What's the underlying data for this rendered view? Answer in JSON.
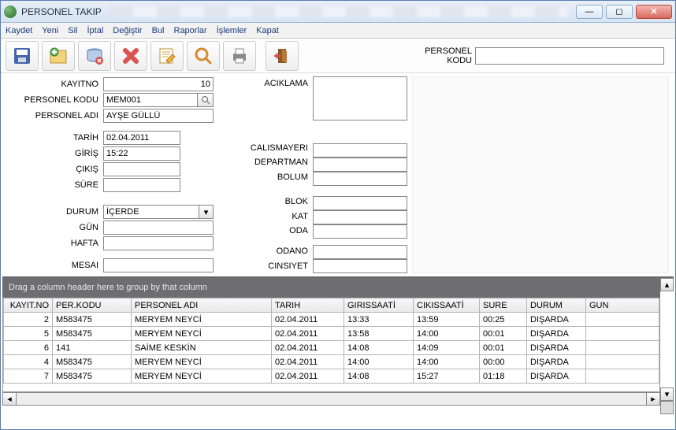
{
  "window": {
    "title": "PERSONEL TAKIP"
  },
  "menubar": [
    "Kaydet",
    "Yeni",
    "Sil",
    "İptal",
    "Değiştir",
    "Bul",
    "Raporlar",
    "İşlemler",
    "Kapat"
  ],
  "headerLookup": {
    "label1": "PERSONEL",
    "label2": "KODU",
    "value": ""
  },
  "form": {
    "kayitno_label": "KAYITNO",
    "kayitno": "10",
    "personelkodu_label": "PERSONEL KODU",
    "personelkodu": "MEM001",
    "personeladi_label": "PERSONEL ADI",
    "personeladi": "AYŞE GÜLLÜ",
    "tarih_label": "TARİH",
    "tarih": "02.04.2011",
    "giris_label": "GİRİŞ",
    "giris": "15:22",
    "cikis_label": "ÇIKIŞ",
    "cikis": "",
    "sure_label": "SÜRE",
    "sure": "",
    "durum_label": "DURUM",
    "durum": "İÇERDE",
    "gun_label": "GÜN",
    "gun": "",
    "hafta_label": "HAFTA",
    "hafta": "",
    "mesai_label": "MESAI",
    "mesai": "",
    "aciklama_label": "ACIKLAMA",
    "aciklama": "",
    "calismayeri_label": "CALISMAYERI",
    "calismayeri": "",
    "departman_label": "DEPARTMAN",
    "departman": "",
    "bolum_label": "BOLUM",
    "bolum": "",
    "blok_label": "BLOK",
    "blok": "",
    "kat_label": "KAT",
    "kat": "",
    "oda_label": "ODA",
    "oda": "",
    "odano_label": "ODANO",
    "odano": "",
    "cinsiyet_label": "CINSIYET",
    "cinsiyet": ""
  },
  "grid": {
    "groupHint": "Drag a column header here to group by that column",
    "columns": [
      "KAYIT.NO",
      "PER.KODU",
      "PERSONEL ADI",
      "TARIH",
      "GIRISSAATİ",
      "CIKISSAATİ",
      "SURE",
      "DURUM",
      "GUN"
    ],
    "rows": [
      {
        "no": "2",
        "kodu": "M583475",
        "adi": "MERYEM NEYCİ",
        "tarih": "02.04.2011",
        "giris": "13:33",
        "cikis": "13:59",
        "sure": "00:25",
        "durum": "DIŞARDA",
        "gun": ""
      },
      {
        "no": "5",
        "kodu": "M583475",
        "adi": "MERYEM NEYCİ",
        "tarih": "02.04.2011",
        "giris": "13:58",
        "cikis": "14:00",
        "sure": "00:01",
        "durum": "DIŞARDA",
        "gun": ""
      },
      {
        "no": "6",
        "kodu": "141",
        "adi": "SAİME KESKİN",
        "tarih": "02.04.2011",
        "giris": "14:08",
        "cikis": "14:09",
        "sure": "00:01",
        "durum": "DIŞARDA",
        "gun": ""
      },
      {
        "no": "4",
        "kodu": "M583475",
        "adi": "MERYEM NEYCİ",
        "tarih": "02.04.2011",
        "giris": "14:00",
        "cikis": "14:00",
        "sure": "00:00",
        "durum": "DIŞARDA",
        "gun": ""
      },
      {
        "no": "7",
        "kodu": "M583475",
        "adi": "MERYEM NEYCİ",
        "tarih": "02.04.2011",
        "giris": "14:08",
        "cikis": "15:27",
        "sure": "01:18",
        "durum": "DIŞARDA",
        "gun": ""
      }
    ]
  }
}
